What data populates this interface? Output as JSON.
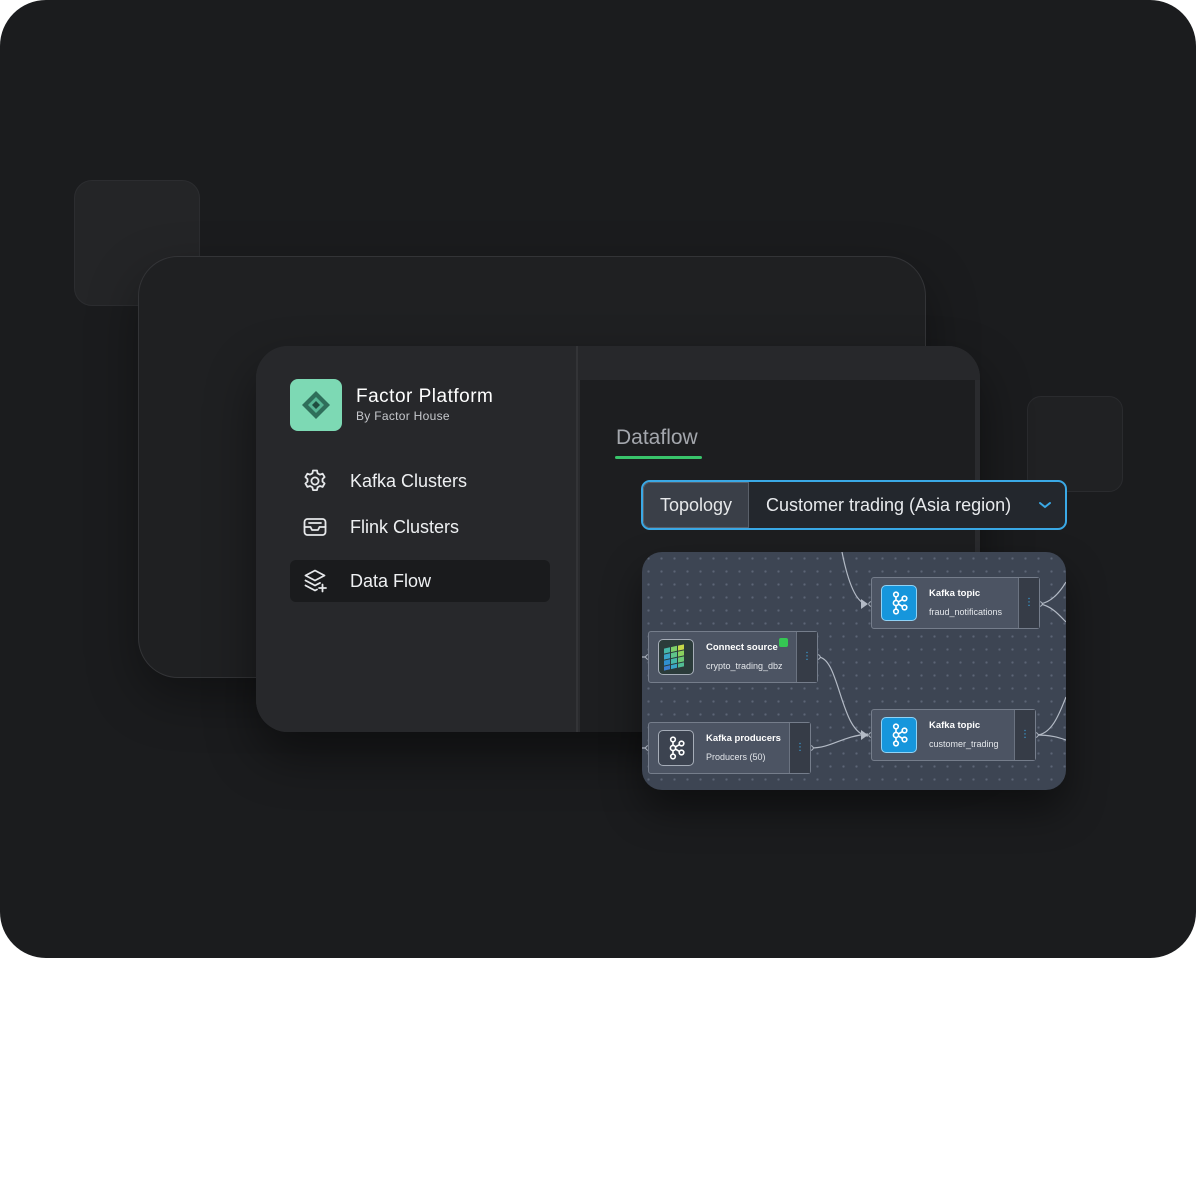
{
  "app": {
    "name": "Factor Platform",
    "tagline": "By Factor House"
  },
  "sidebar": {
    "items": [
      {
        "label": "Kafka Clusters",
        "icon": "gear-icon",
        "active": false
      },
      {
        "label": "Flink Clusters",
        "icon": "inbox-tray-icon",
        "active": false
      },
      {
        "label": "Data Flow",
        "icon": "layers-plus-icon",
        "active": true
      }
    ]
  },
  "main": {
    "tab": "Dataflow",
    "view_selector": {
      "label": "Topology",
      "value": "Customer trading (Asia region)"
    }
  },
  "topology": {
    "nodes": [
      {
        "type": "Kafka topic",
        "name": "fraud_notifications",
        "icon": "kafka-icon"
      },
      {
        "type": "Connect source",
        "name": "crypto_trading_dbz",
        "icon": "connect-icon",
        "status": "running"
      },
      {
        "type": "Kafka producers",
        "name": "Producers (50)",
        "icon": "kafka-producer-icon"
      },
      {
        "type": "Kafka topic",
        "name": "customer_trading",
        "icon": "kafka-icon"
      }
    ]
  },
  "colors": {
    "background": "#1b1c1e",
    "accent_green": "#39c46b",
    "accent_blue": "#3aa9e6",
    "logo": "#7dd9b4",
    "kafka_blue": "#1696dc",
    "status_green": "#35c653"
  }
}
